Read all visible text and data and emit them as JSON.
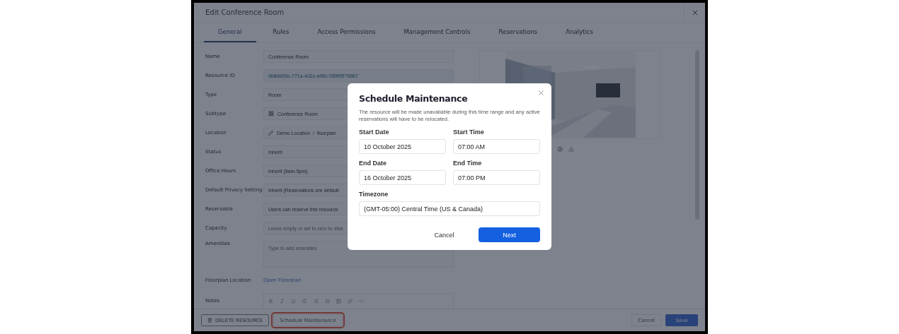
{
  "window": {
    "title": "Edit Conference Room"
  },
  "tabs": [
    {
      "label": "General",
      "selected": true
    },
    {
      "label": "Rules",
      "selected": false
    },
    {
      "label": "Access Permissions",
      "selected": false
    },
    {
      "label": "Management Controls",
      "selected": false
    },
    {
      "label": "Reservations",
      "selected": false
    },
    {
      "label": "Analytics",
      "selected": false
    }
  ],
  "form": {
    "fields": [
      {
        "label": "Name",
        "kind": "input",
        "value": "Conference Room"
      },
      {
        "label": "Resource ID",
        "kind": "id",
        "value": "0b8dd09c-771a-4d2c-a98c-f35f6f579667"
      },
      {
        "label": "Type",
        "kind": "input",
        "value": "Room"
      },
      {
        "label": "Subtype",
        "kind": "subtype",
        "value": "Conference Room"
      },
      {
        "label": "Location",
        "kind": "location",
        "value": "Demo Location  /  floorplan"
      },
      {
        "label": "Status",
        "kind": "input",
        "value": "Inherit"
      },
      {
        "label": "Office Hours",
        "kind": "input",
        "value": "Inherit (9am-5pm)"
      },
      {
        "label": "Default Privacy Setting",
        "kind": "input",
        "value": "Inherit (Reservations are default"
      },
      {
        "label": "Reservable",
        "kind": "input",
        "value": "Users can reserve this resource"
      },
      {
        "label": "Capacity",
        "kind": "input",
        "placeholder": "Leave empty or set to zero to disa"
      },
      {
        "label": "Amenities",
        "kind": "textarea",
        "placeholder": "Type to add amenities"
      },
      {
        "label": "Floorplan Location",
        "kind": "link",
        "value": "Open Floorplan"
      },
      {
        "label": "Notes",
        "kind": "editor"
      }
    ]
  },
  "footer": {
    "left": [
      {
        "label": "DELETE RESOURCE",
        "kind": "delete",
        "highlighted": false
      },
      {
        "label": "Schedule Maintenance",
        "kind": "plain",
        "highlighted": true
      }
    ],
    "right": [
      {
        "label": "Cancel",
        "kind": "plain"
      },
      {
        "label": "Save",
        "kind": "primary"
      }
    ]
  },
  "dialog": {
    "title": "Schedule Maintenance",
    "description": "The resource will be made unavailable during this time range and any active reservations will have to be relocated.",
    "fields": [
      {
        "label": "Start Date",
        "value": "10 October 2025"
      },
      {
        "label": "Start Time",
        "value": "07:00 AM"
      },
      {
        "label": "End Date",
        "value": "16 October 2025"
      },
      {
        "label": "End Time",
        "value": "07:00 PM"
      },
      {
        "label": "Timezone",
        "value": "(GMT-05:00) Central Time (US & Canada)"
      }
    ],
    "buttons": [
      {
        "label": "Cancel",
        "kind": "plain"
      },
      {
        "label": "Next",
        "kind": "primary"
      }
    ]
  }
}
